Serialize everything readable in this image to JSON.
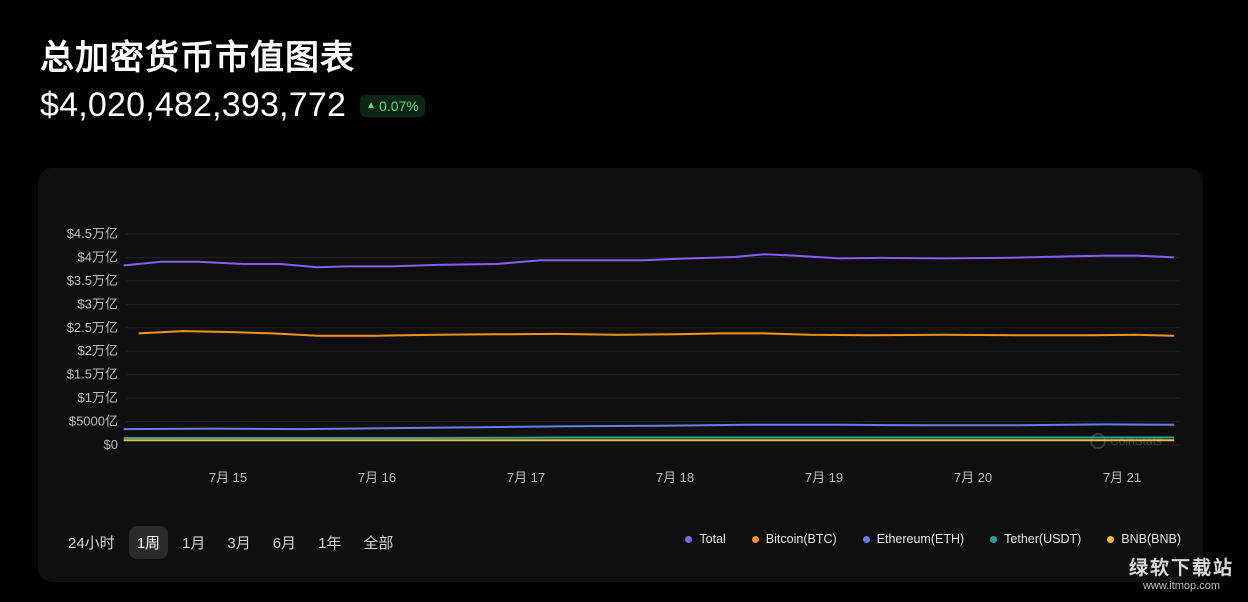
{
  "header": {
    "title": "总加密货币市值图表",
    "market_cap": "$4,020,482,393,772",
    "change": "0.07%",
    "change_color": "#4ade80"
  },
  "range_selector": {
    "options": [
      "24小时",
      "1周",
      "1月",
      "3月",
      "6月",
      "1年",
      "全部"
    ],
    "active": "1周"
  },
  "chart_data": {
    "type": "line",
    "x_ticks": [
      "7月 15",
      "7月 16",
      "7月 17",
      "7月 18",
      "7月 19",
      "7月 20",
      "7月 21"
    ],
    "y_ticks": [
      "$0",
      "$5000亿",
      "$1万亿",
      "$1.5万亿",
      "$2万亿",
      "$2.5万亿",
      "$3万亿",
      "$3.5万亿",
      "$4万亿",
      "$4.5万亿"
    ],
    "ylim": [
      0,
      4.5
    ],
    "y_unit": "万亿 USD",
    "grid": true,
    "legend_position": "bottom-right",
    "watermark": "CoinStats",
    "series": [
      {
        "name": "Total",
        "color": "#8b5cf6",
        "points": [
          [
            14.3,
            3.83
          ],
          [
            14.55,
            3.91
          ],
          [
            14.8,
            3.91
          ],
          [
            15.1,
            3.86
          ],
          [
            15.35,
            3.86
          ],
          [
            15.6,
            3.79
          ],
          [
            15.8,
            3.81
          ],
          [
            16.1,
            3.81
          ],
          [
            16.4,
            3.84
          ],
          [
            16.8,
            3.86
          ],
          [
            17.1,
            3.94
          ],
          [
            17.4,
            3.94
          ],
          [
            17.8,
            3.94
          ],
          [
            18.0,
            3.97
          ],
          [
            18.4,
            4.01
          ],
          [
            18.6,
            4.07
          ],
          [
            18.8,
            4.04
          ],
          [
            19.1,
            3.98
          ],
          [
            19.4,
            3.99
          ],
          [
            19.8,
            3.98
          ],
          [
            20.2,
            3.99
          ],
          [
            20.6,
            4.02
          ],
          [
            20.9,
            4.04
          ],
          [
            21.1,
            4.04
          ],
          [
            21.35,
            4.0
          ]
        ]
      },
      {
        "name": "Bitcoin(BTC)",
        "color": "#f7931a",
        "points": [
          [
            14.4,
            2.38
          ],
          [
            14.7,
            2.43
          ],
          [
            15.0,
            2.41
          ],
          [
            15.3,
            2.38
          ],
          [
            15.6,
            2.33
          ],
          [
            16.0,
            2.33
          ],
          [
            16.4,
            2.35
          ],
          [
            16.8,
            2.36
          ],
          [
            17.2,
            2.37
          ],
          [
            17.6,
            2.35
          ],
          [
            18.0,
            2.36
          ],
          [
            18.3,
            2.38
          ],
          [
            18.6,
            2.38
          ],
          [
            18.9,
            2.35
          ],
          [
            19.3,
            2.34
          ],
          [
            19.8,
            2.35
          ],
          [
            20.3,
            2.34
          ],
          [
            20.8,
            2.34
          ],
          [
            21.1,
            2.35
          ],
          [
            21.35,
            2.33
          ]
        ]
      },
      {
        "name": "Ethereum(ETH)",
        "color": "#627eea",
        "points": [
          [
            14.3,
            0.34
          ],
          [
            14.9,
            0.35
          ],
          [
            15.5,
            0.34
          ],
          [
            16.1,
            0.36
          ],
          [
            16.7,
            0.38
          ],
          [
            17.3,
            0.4
          ],
          [
            17.9,
            0.41
          ],
          [
            18.5,
            0.43
          ],
          [
            19.1,
            0.43
          ],
          [
            19.7,
            0.42
          ],
          [
            20.3,
            0.42
          ],
          [
            20.9,
            0.44
          ],
          [
            21.35,
            0.43
          ]
        ]
      },
      {
        "name": "Tether(USDT)",
        "color": "#26a69a",
        "points": [
          [
            14.3,
            0.15
          ],
          [
            15.3,
            0.15
          ],
          [
            16.3,
            0.15
          ],
          [
            17.3,
            0.16
          ],
          [
            18.3,
            0.16
          ],
          [
            19.3,
            0.16
          ],
          [
            20.3,
            0.16
          ],
          [
            21.35,
            0.16
          ]
        ]
      },
      {
        "name": "BNB(BNB)",
        "color": "#f3ba2f",
        "points": [
          [
            14.3,
            0.1
          ],
          [
            15.3,
            0.1
          ],
          [
            16.3,
            0.1
          ],
          [
            17.3,
            0.1
          ],
          [
            18.3,
            0.1
          ],
          [
            19.3,
            0.1
          ],
          [
            20.3,
            0.1
          ],
          [
            21.35,
            0.1
          ]
        ]
      }
    ]
  },
  "footer_watermark": {
    "main": "绿软下载站",
    "sub": "www.itmop.com"
  }
}
